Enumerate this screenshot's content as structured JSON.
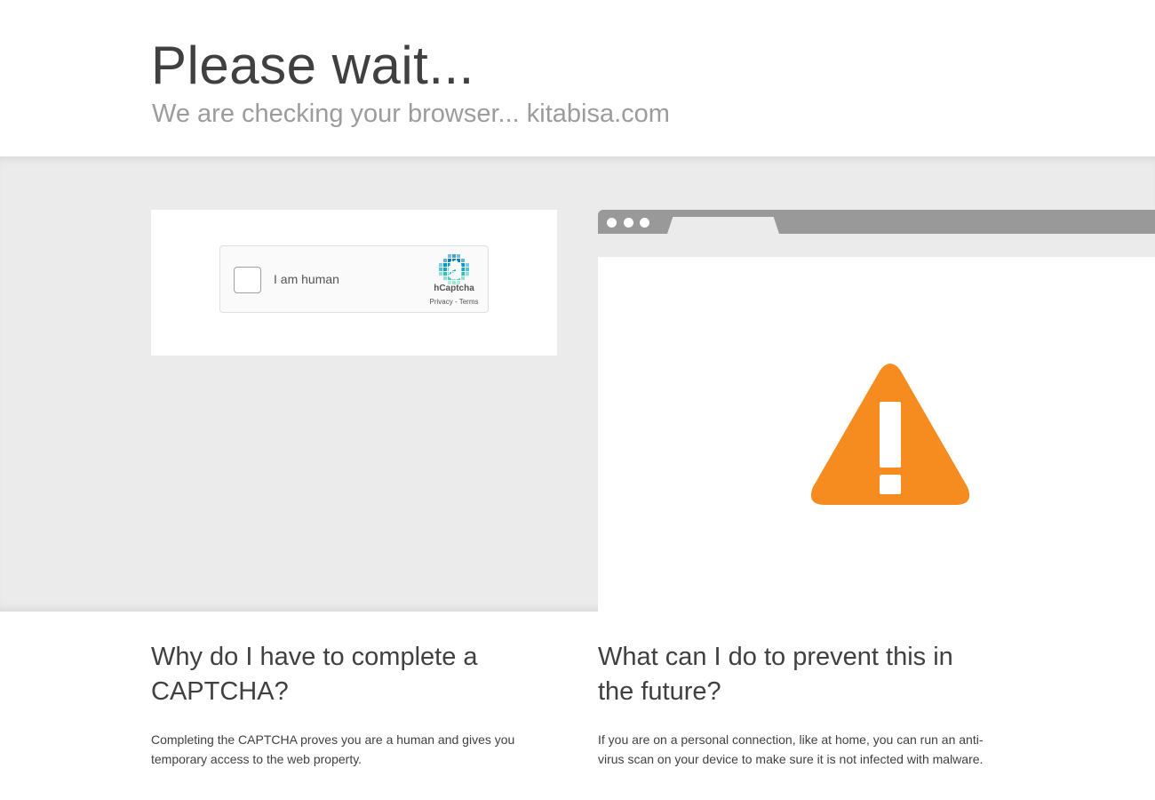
{
  "header": {
    "title": "Please wait...",
    "subtitle": "We are checking your browser... kitabisa.com"
  },
  "captcha": {
    "checkbox_label": "I am human",
    "brand": "hCaptcha",
    "privacy_link": "Privacy",
    "separator": "-",
    "terms_link": "Terms",
    "logo_icon": "hcaptcha-hand-icon"
  },
  "illustration": {
    "icon": "warning-triangle-icon",
    "accent_color": "#f68b1f"
  },
  "faq": [
    {
      "question": "Why do I have to complete a CAPTCHA?",
      "answer": "Completing the CAPTCHA proves you are a human and gives you temporary access to the web property."
    },
    {
      "question": "What can I do to prevent this in the future?",
      "answer": "If you are on a personal connection, like at home, you can run an anti-virus scan on your device to make sure it is not infected with malware."
    }
  ]
}
